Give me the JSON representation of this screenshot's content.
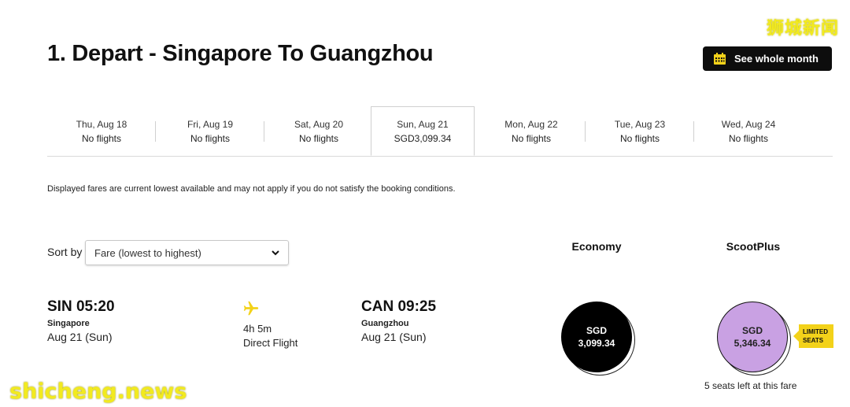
{
  "header": {
    "title": "1. Depart - Singapore To Guangzhou",
    "see_month_label": "See whole month"
  },
  "watermarks": {
    "top": "狮城新闻",
    "bottom": "shicheng.news"
  },
  "date_tabs": [
    {
      "day": "Thu, Aug 18",
      "sub": "No flights"
    },
    {
      "day": "Fri, Aug 19",
      "sub": "No flights"
    },
    {
      "day": "Sat, Aug 20",
      "sub": "No flights"
    },
    {
      "day": "Sun, Aug 21",
      "sub": "SGD3,099.34",
      "selected": true
    },
    {
      "day": "Mon, Aug 22",
      "sub": "No flights"
    },
    {
      "day": "Tue, Aug 23",
      "sub": "No flights"
    },
    {
      "day": "Wed, Aug 24",
      "sub": "No flights"
    }
  ],
  "fare_note": "Displayed fares are current lowest available and may not apply if you do not satisfy the booking conditions.",
  "sort": {
    "label": "Sort by",
    "selected": "Fare (lowest to highest)"
  },
  "columns": {
    "economy": "Economy",
    "scootplus": "ScootPlus"
  },
  "flight": {
    "depart_time": "SIN 05:20",
    "depart_city": "Singapore",
    "depart_date": "Aug 21 (Sun)",
    "duration": "4h 5m",
    "stops": "Direct Flight",
    "arrive_time": "CAN 09:25",
    "arrive_city": "Guangzhou",
    "arrive_date": "Aug 21 (Sun)",
    "economy_currency": "SGD",
    "economy_price": "3,099.34",
    "scootplus_currency": "SGD",
    "scootplus_price": "5,346.34",
    "limited_line1": "LIMITED",
    "limited_line2": "SEATS",
    "seats_left": "5 seats left at this fare"
  },
  "colors": {
    "accent_yellow": "#f3d21a",
    "scootplus_purple": "#c9a1e3",
    "button_black": "#0d0d0d"
  },
  "icons": [
    "calendar-icon",
    "chevron-down-icon",
    "plane-icon"
  ]
}
